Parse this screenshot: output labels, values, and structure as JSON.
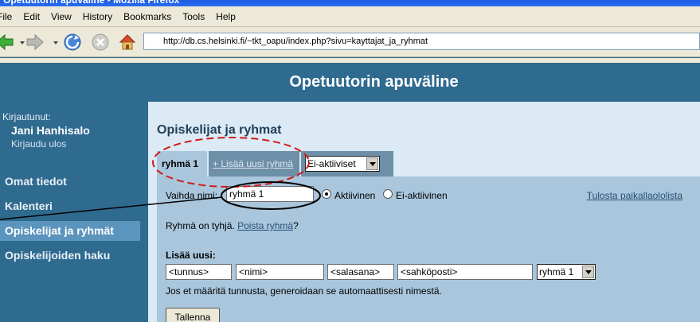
{
  "browser": {
    "title": "Opetuutorin apuväline - Mozilla Firefox",
    "menu": [
      "File",
      "Edit",
      "View",
      "History",
      "Bookmarks",
      "Tools",
      "Help"
    ],
    "url": "http://db.cs.helsinki.fi/~tkt_oapu/index.php?sivu=kayttajat_ja_ryhmat"
  },
  "header": {
    "app_title": "Opetuutorin apuväline"
  },
  "sidebar": {
    "logged_in_label": "Kirjautunut:",
    "user_name": "Jani Hanhisalo",
    "logout": "Kirjaudu ulos",
    "items": [
      {
        "label": "Omat tiedot"
      },
      {
        "label": "Kalenteri"
      },
      {
        "label": "Opiskelijat ja ryhmät"
      },
      {
        "label": "Opiskelijoiden haku"
      }
    ]
  },
  "main": {
    "title": "Opiskelijat ja ryhmat",
    "tabs": {
      "group_tab": "ryhmä 1",
      "add_group": "+ Lisää uusi ryhmä",
      "inactive_select": "Ei-aktiiviset"
    },
    "rename": {
      "label": "Vaihda nimi:",
      "value": "ryhmä 1",
      "active_label": "Aktiivinen",
      "inactive_label": "Ei-aktiivinen",
      "selected": "Aktiivinen"
    },
    "print_link": "Tulosta paikallaololista",
    "empty_text": "Ryhmä on tyhjä.",
    "delete_group": "Poista ryhmä",
    "question_mark": "?",
    "add_new": {
      "label": "Lisää uusi:",
      "fields": [
        "<tunnus>",
        "<nimi>",
        "<salasana>",
        "<sahköposti>"
      ],
      "group_select": "ryhmä 1",
      "hint": "Jos et määritä tunnusta, generoidaan se automaattisesti nimestä.",
      "save_button": "Tallenna"
    }
  },
  "colors": {
    "brand_blue": "#2f6a8f",
    "content_bg": "#dbeaf5",
    "panel_bg": "#a9c6dc",
    "annotation_red": "#d11a1a"
  }
}
